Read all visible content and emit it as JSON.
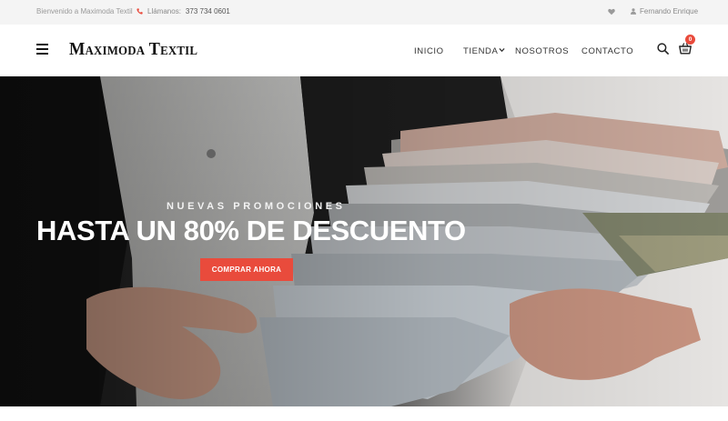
{
  "topbar": {
    "welcome": "Bienvenido a Maximoda Textil",
    "phone_label": "Llámanos:",
    "phone_number": "373 734 0601",
    "user_name": "Fernando Enrique"
  },
  "header": {
    "logo": "Maximoda Textil",
    "nav": [
      "INICIO",
      "TIENDA",
      "NOSOTROS",
      "CONTACTO"
    ],
    "cart_count": "0"
  },
  "hero": {
    "subtitle": "NUEVAS PROMOCIONES",
    "headline": "HASTA UN 80% DE DESCUENTO",
    "cta": "COMPRAR AHORA"
  },
  "colors": {
    "accent": "#e94b3c",
    "topbar_bg": "#f4f4f4"
  },
  "icons": [
    "menu-icon",
    "phone-icon",
    "heart-icon",
    "user-icon",
    "search-icon",
    "cart-icon",
    "chevron-down-icon"
  ]
}
